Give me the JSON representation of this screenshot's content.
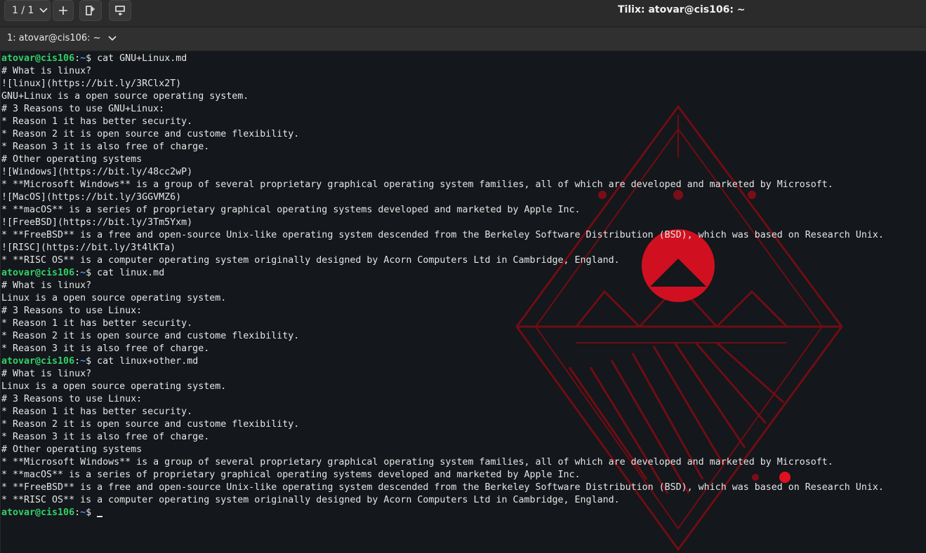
{
  "header": {
    "session_label": "1 / 1",
    "title": "Tilix: atovar@cis106: ~"
  },
  "terminal_bar": {
    "title": "1: atovar@cis106: ~"
  },
  "icons": {
    "session": "chevron-down-icon",
    "add": "plus-icon",
    "split_horizontal": "split-horizontal-icon",
    "split_vertical": "split-vertical-icon",
    "terminal_menu": "chevron-down-icon"
  },
  "colors": {
    "prompt_user": "#33d16a",
    "prompt_path": "#4f8ff7",
    "terminal_text": "#e6e6e6",
    "background_art": "#c4101f"
  },
  "prompt": {
    "user": "atovar@cis106",
    "sep": ":",
    "path": "~",
    "dollar": "$"
  },
  "terminal": {
    "lines": [
      {
        "type": "prompt",
        "cmd": " cat GNU+Linux.md"
      },
      {
        "type": "out",
        "text": "# What is linux?"
      },
      {
        "type": "out",
        "text": "![linux](https://bit.ly/3RClx2T)"
      },
      {
        "type": "out",
        "text": "GNU+Linux is a open source operating system."
      },
      {
        "type": "out",
        "text": "# 3 Reasons to use GNU+Linux:"
      },
      {
        "type": "out",
        "text": "* Reason 1 it has better security."
      },
      {
        "type": "out",
        "text": "* Reason 2 it is open source and custome flexibility."
      },
      {
        "type": "out",
        "text": "* Reason 3 it is also free of charge."
      },
      {
        "type": "out",
        "text": "# Other operating systems"
      },
      {
        "type": "out",
        "text": "![Windows](https://bit.ly/48cc2wP)"
      },
      {
        "type": "out",
        "text": "* **Microsoft Windows** is a group of several proprietary graphical operating system families, all of which are developed and marketed by Microsoft."
      },
      {
        "type": "out",
        "text": "![MacOS](https://bit.ly/3GGVMZ6)"
      },
      {
        "type": "out",
        "text": "* **macOS** is a series of proprietary graphical operating systems developed and marketed by Apple Inc."
      },
      {
        "type": "out",
        "text": "![FreeBSD](https://bit.ly/3Tm5Yxm)"
      },
      {
        "type": "out",
        "text": "* **FreeBSD** is a free and open-source Unix-like operating system descended from the Berkeley Software Distribution (BSD), which was based on Research Unix."
      },
      {
        "type": "out",
        "text": "![RISC](https://bit.ly/3t4lKTa)"
      },
      {
        "type": "out",
        "text": "* **RISC OS** is a computer operating system originally designed by Acorn Computers Ltd in Cambridge, England."
      },
      {
        "type": "prompt",
        "cmd": " cat linux.md"
      },
      {
        "type": "out",
        "text": "# What is linux?"
      },
      {
        "type": "out",
        "text": "Linux is a open source operating system."
      },
      {
        "type": "out",
        "text": "# 3 Reasons to use Linux:"
      },
      {
        "type": "out",
        "text": "* Reason 1 it has better security."
      },
      {
        "type": "out",
        "text": "* Reason 2 it is open source and custome flexibility."
      },
      {
        "type": "out",
        "text": "* Reason 3 it is also free of charge."
      },
      {
        "type": "prompt",
        "cmd": " cat linux+other.md"
      },
      {
        "type": "out",
        "text": "# What is linux?"
      },
      {
        "type": "out",
        "text": "Linux is a open source operating system."
      },
      {
        "type": "out",
        "text": "# 3 Reasons to use Linux:"
      },
      {
        "type": "out",
        "text": "* Reason 1 it has better security."
      },
      {
        "type": "out",
        "text": "* Reason 2 it is open source and custome flexibility."
      },
      {
        "type": "out",
        "text": "* Reason 3 it is also free of charge."
      },
      {
        "type": "out",
        "text": "# Other operating systems"
      },
      {
        "type": "out",
        "text": "* **Microsoft Windows** is a group of several proprietary graphical operating system families, all of which are developed and marketed by Microsoft."
      },
      {
        "type": "out",
        "text": "* **macOS** is a series of proprietary graphical operating systems developed and marketed by Apple Inc."
      },
      {
        "type": "out",
        "text": "* **FreeBSD** is a free and open-source Unix-like operating system descended from the Berkeley Software Distribution (BSD), which was based on Research Unix."
      },
      {
        "type": "out",
        "text": "* **RISC OS** is a computer operating system originally designed by Acorn Computers Ltd in Cambridge, England."
      },
      {
        "type": "prompt",
        "cmd": " ",
        "cursor": true
      }
    ]
  }
}
